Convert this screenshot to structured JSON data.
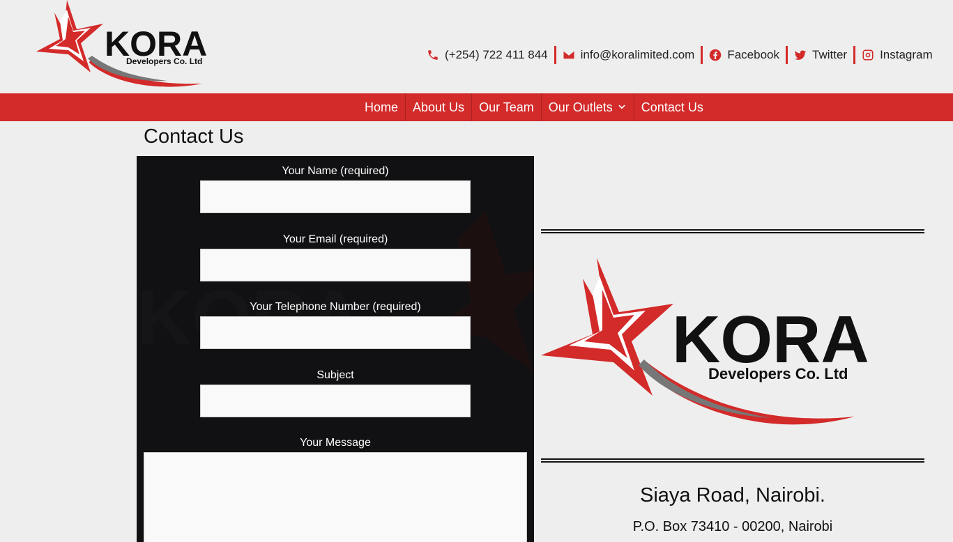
{
  "brand": {
    "name": "KORA",
    "tagline": "Developers Co. Ltd",
    "accent": "#d32a2a"
  },
  "topbar": {
    "phone": "(+254) 722 411 844",
    "email": "info@koralimited.com",
    "facebook": "Facebook",
    "twitter": "Twitter",
    "instagram": "Instagram"
  },
  "nav": {
    "home": "Home",
    "about": "About Us",
    "team": "Our Team",
    "outlets": "Our Outlets",
    "contact": "Contact Us"
  },
  "page": {
    "title": "Contact Us"
  },
  "form": {
    "name_label": "Your Name (required)",
    "email_label": "Your Email (required)",
    "phone_label": "Your Telephone Number (required)",
    "subject_label": "Subject",
    "message_label": "Your Message"
  },
  "contact": {
    "address": "Siaya Road, Nairobi.",
    "pobox": "P.O. Box 73410 - 00200, Nairobi"
  }
}
